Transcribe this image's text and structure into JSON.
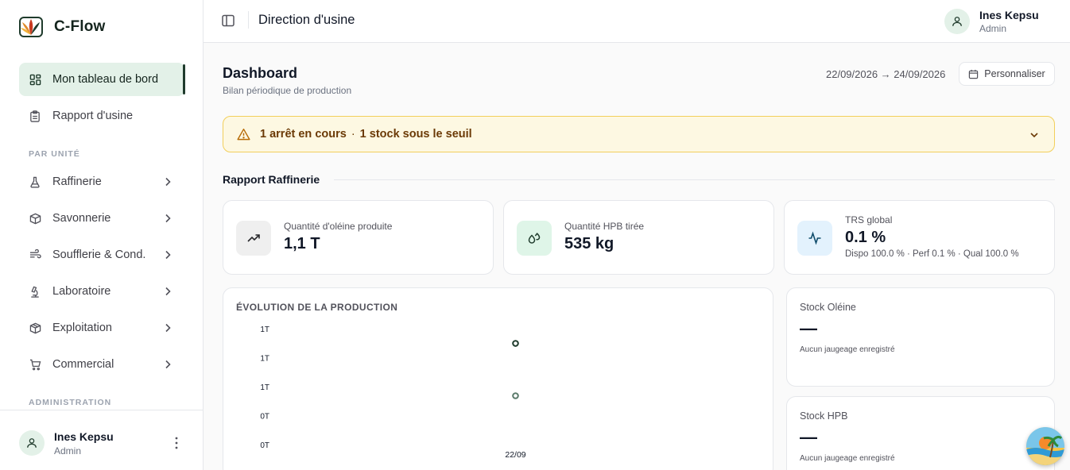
{
  "app": {
    "name": "C-Flow"
  },
  "sidebar": {
    "items": [
      {
        "label": "Mon tableau de bord",
        "icon": "layout-grid-icon",
        "active": true
      },
      {
        "label": "Rapport d'usine",
        "icon": "clipboard-icon"
      }
    ],
    "section_units": "PAR UNITÉ",
    "unit_items": [
      {
        "label": "Raffinerie",
        "icon": "flask-icon"
      },
      {
        "label": "Savonnerie",
        "icon": "cube-icon"
      },
      {
        "label": "Soufflerie & Cond.",
        "icon": "wind-icon"
      },
      {
        "label": "Laboratoire",
        "icon": "microscope-icon"
      },
      {
        "label": "Exploitation",
        "icon": "package-icon"
      },
      {
        "label": "Commercial",
        "icon": "cart-icon"
      }
    ],
    "section_admin": "ADMINISTRATION",
    "user": {
      "name": "Ines Kepsu",
      "role": "Admin"
    }
  },
  "header": {
    "title": "Direction d'usine",
    "user": {
      "name": "Ines Kepsu",
      "role": "Admin"
    }
  },
  "page": {
    "title": "Dashboard",
    "subtitle": "Bilan périodique de production",
    "date_range": "22/09/2026 → 24/09/2026",
    "customize_label": "Personnaliser"
  },
  "alert": {
    "part1": "1 arrêt en cours",
    "separator": "·",
    "part2": "1 stock sous le seuil",
    "color": "#f2cf5b"
  },
  "section": {
    "title": "Rapport Raffinerie"
  },
  "kpis": [
    {
      "label": "Quantité d'oléine produite",
      "value": "1,1 T",
      "icon": "trending-up-icon",
      "bg": "#efefef"
    },
    {
      "label": "Quantité HPB tirée",
      "value": "535 kg",
      "icon": "droplets-icon",
      "bg": "#dff5e8"
    },
    {
      "label": "TRS global",
      "value": "0.1 %",
      "sub": "Dispo 100.0 % · Perf 0.1 % · Qual 100.0 %",
      "icon": "activity-icon",
      "bg": "#e3f2fd"
    }
  ],
  "chart": {
    "title": "ÉVOLUTION DE LA PRODUCTION"
  },
  "chart_data": {
    "type": "scatter",
    "title": "ÉVOLUTION DE LA PRODUCTION",
    "y_tick_labels": [
      "1T",
      "1T",
      "1T",
      "0T",
      "0T"
    ],
    "x_tick_labels": [
      "22/09"
    ],
    "ylim": [
      0,
      1.25
    ],
    "series": [
      {
        "x": [
          "22/09"
        ],
        "values": [
          1.1
        ],
        "color": "#1f3b2c"
      },
      {
        "x": [
          "22/09"
        ],
        "values": [
          0.535
        ],
        "color": "#5a7a6a"
      }
    ]
  },
  "stocks": [
    {
      "title": "Stock Oléine",
      "value": "—",
      "sub": "Aucun jaugeage enregistré"
    },
    {
      "title": "Stock HPB",
      "value": "—",
      "sub": "Aucun jaugeage enregistré"
    }
  ]
}
